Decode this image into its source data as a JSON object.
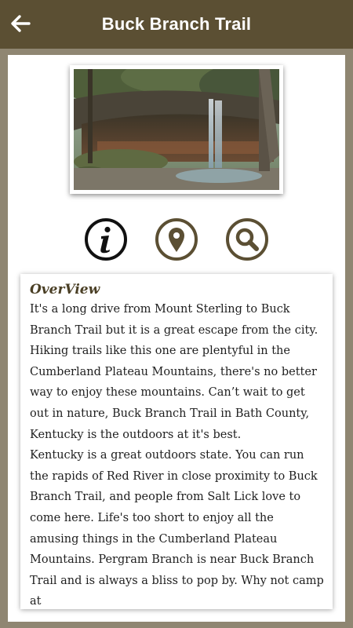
{
  "header": {
    "title": "Buck Branch Trail",
    "back_icon": "arrow-left-icon"
  },
  "photo": {
    "subject": "waterfall-photo"
  },
  "actions": [
    {
      "icon": "info-icon",
      "color": "#111111"
    },
    {
      "icon": "map-pin-icon",
      "color": "#5b4f33"
    },
    {
      "icon": "search-icon",
      "color": "#5b4f33"
    }
  ],
  "overview": {
    "title": "OverView",
    "paragraphs": [
      "It's a long drive from Mount Sterling to Buck Branch Trail but it is a great escape from the city. Hiking trails like this one are plentyful in the Cumberland Plateau Mountains, there's no better way to enjoy these mountains. Can’t wait to get out in nature, Buck Branch Trail in Bath County, Kentucky is the outdoors at it's best.",
      "Kentucky is a great outdoors state. You can run the rapids of Red River in close proximity to Buck Branch Trail, and people from Salt Lick love to come here. Life's too short to enjoy all the amusing things in the Cumberland Plateau Mountains. Pergram Branch is near Buck Branch Trail and is always a bliss to pop by. Why not camp at"
    ]
  },
  "colors": {
    "header_bg": "#5b4f33",
    "frame_bg": "#8f8672",
    "accent": "#5b4f33"
  }
}
